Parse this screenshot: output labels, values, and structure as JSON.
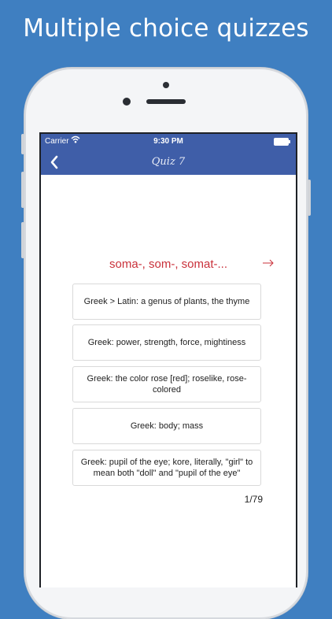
{
  "promo": {
    "headline": "Multiple choice quizzes"
  },
  "statusbar": {
    "carrier": "Carrier",
    "time": "9:30 PM"
  },
  "navbar": {
    "title": "Quiz 7"
  },
  "quiz": {
    "question": "soma-, som-, somat-...",
    "choices": [
      "Greek > Latin: a genus of plants, the thyme",
      "Greek: power, strength, force, mightiness",
      "Greek: the color rose [red]; roselike, rose-colored",
      "Greek: body; mass",
      "Greek: pupil of the eye; kore, literally, \"girl\" to mean both \"doll\" and \"pupil of the eye\""
    ],
    "progress": "1/79"
  },
  "colors": {
    "background": "#3f7fc1",
    "navbar": "#3f5ea8",
    "question": "#c9303a"
  },
  "icons": [
    "wifi-icon",
    "battery-icon",
    "back-chevron-icon",
    "next-arrow-icon"
  ]
}
